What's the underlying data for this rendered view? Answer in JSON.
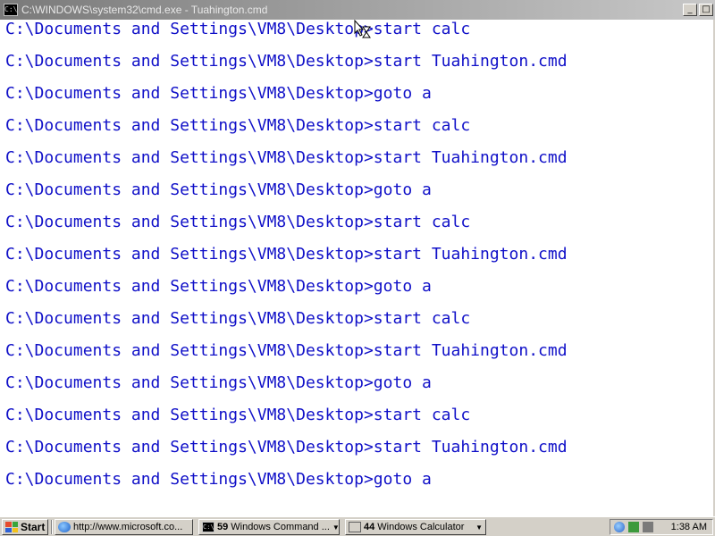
{
  "window": {
    "title": "C:\\WINDOWS\\system32\\cmd.exe - Tuahington.cmd",
    "icon_text": "C:\\"
  },
  "console": {
    "lines": [
      "C:\\Documents and Settings\\VM8\\Desktop>start calc",
      "C:\\Documents and Settings\\VM8\\Desktop>start Tuahington.cmd",
      "C:\\Documents and Settings\\VM8\\Desktop>goto a",
      "C:\\Documents and Settings\\VM8\\Desktop>start calc",
      "C:\\Documents and Settings\\VM8\\Desktop>start Tuahington.cmd",
      "C:\\Documents and Settings\\VM8\\Desktop>goto a",
      "C:\\Documents and Settings\\VM8\\Desktop>start calc",
      "C:\\Documents and Settings\\VM8\\Desktop>start Tuahington.cmd",
      "C:\\Documents and Settings\\VM8\\Desktop>goto a",
      "C:\\Documents and Settings\\VM8\\Desktop>start calc",
      "C:\\Documents and Settings\\VM8\\Desktop>start Tuahington.cmd",
      "C:\\Documents and Settings\\VM8\\Desktop>goto a",
      "C:\\Documents and Settings\\VM8\\Desktop>start calc",
      "C:\\Documents and Settings\\VM8\\Desktop>start Tuahington.cmd",
      "C:\\Documents and Settings\\VM8\\Desktop>goto a"
    ],
    "text_color": "#1010c8",
    "background": "#ffffff"
  },
  "taskbar": {
    "start_label": "Start",
    "tasks": [
      {
        "icon": "ie-icon",
        "count": "",
        "label": "http://www.microsoft.co..."
      },
      {
        "icon": "cmd-icon",
        "count": "59",
        "label": "Windows Command ..."
      },
      {
        "icon": "calculator-icon",
        "count": "44",
        "label": "Windows Calculator"
      }
    ],
    "clock": "1:38 AM"
  }
}
